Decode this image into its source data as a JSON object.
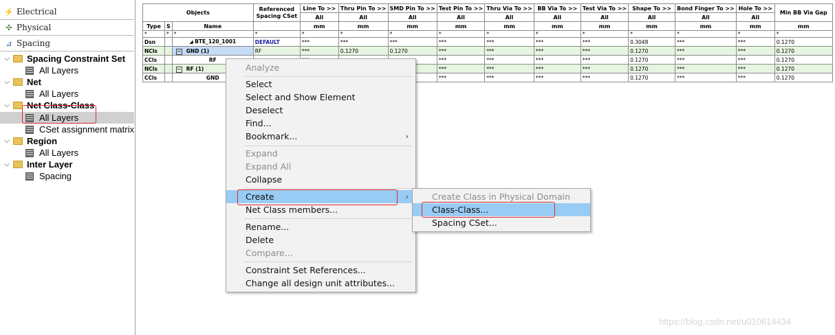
{
  "left_tabs": [
    {
      "label": "Electrical",
      "icon": "lightning-icon"
    },
    {
      "label": "Physical",
      "icon": "physical-icon"
    },
    {
      "label": "Spacing",
      "icon": "spacing-icon"
    }
  ],
  "tree": [
    {
      "label": "Spacing Constraint Set",
      "kind": "folder"
    },
    {
      "label": "All Layers",
      "kind": "layer"
    },
    {
      "label": "Net",
      "kind": "folder"
    },
    {
      "label": "All Layers",
      "kind": "layer"
    },
    {
      "label": "Net Class-Class",
      "kind": "folder"
    },
    {
      "label": "All Layers",
      "kind": "layer"
    },
    {
      "label": "CSet assignment matrix",
      "kind": "layer"
    },
    {
      "label": "Region",
      "kind": "folder"
    },
    {
      "label": "All Layers",
      "kind": "layer"
    },
    {
      "label": "Inter Layer",
      "kind": "folder"
    },
    {
      "label": "Spacing",
      "kind": "layer"
    }
  ],
  "table": {
    "objects": "Objects",
    "ref_cset": "Referenced Spacing CSet",
    "type": "Type",
    "s": "S",
    "name": "Name",
    "columns": [
      "Line To >>",
      "Thru Pin To >>",
      "SMD Pin To >>",
      "Test Pin To >>",
      "Thru Via To >>",
      "BB Via To >>",
      "Test Via To >>",
      "Shape To >>",
      "Bond Finger To >>",
      "Hole To >>",
      "Min BB Via Gap"
    ],
    "all": "All",
    "unit": "mm",
    "filter": "*",
    "rows": [
      {
        "type": "Dsn",
        "name": "BTE_120_1001",
        "cset": "DEFAULT",
        "vals": [
          "***",
          "***",
          "***",
          "***",
          "***",
          "***",
          "***",
          "0.3048",
          "***",
          "***",
          "0.1270"
        ]
      },
      {
        "type": "NCls",
        "name": "GND (1)",
        "cset": "RF",
        "vals": [
          "***",
          "0.1270",
          "0.1270",
          "***",
          "***",
          "***",
          "***",
          "0.1270",
          "***",
          "***",
          "0.1270"
        ]
      },
      {
        "type": "CCls",
        "name": "RF",
        "cset": "",
        "vals": [
          "***",
          "",
          "",
          "***",
          "***",
          "***",
          "***",
          "0.1270",
          "***",
          "***",
          "0.1270"
        ]
      },
      {
        "type": "NCls",
        "name": "RF (1)",
        "cset": "",
        "vals": [
          "***",
          "",
          "",
          "***",
          "***",
          "***",
          "***",
          "0.1270",
          "***",
          "***",
          "0.1270"
        ]
      },
      {
        "type": "CCls",
        "name": "GND",
        "cset": "",
        "vals": [
          "***",
          "",
          "",
          "***",
          "***",
          "***",
          "***",
          "0.1270",
          "***",
          "***",
          "0.1270"
        ]
      }
    ]
  },
  "context_menu": [
    {
      "label": "Analyze",
      "disabled": true
    },
    {
      "sep": true
    },
    {
      "label": "Select"
    },
    {
      "label": "Select and Show Element"
    },
    {
      "label": "Deselect"
    },
    {
      "label": "Find..."
    },
    {
      "label": "Bookmark...",
      "submenu": true
    },
    {
      "sep": true
    },
    {
      "label": "Expand",
      "disabled": true
    },
    {
      "label": "Expand All",
      "disabled": true
    },
    {
      "label": "Collapse"
    },
    {
      "sep": true
    },
    {
      "label": "Create",
      "submenu": true,
      "highlight": true
    },
    {
      "label": "Net Class members..."
    },
    {
      "sep": true
    },
    {
      "label": "Rename..."
    },
    {
      "label": "Delete"
    },
    {
      "label": "Compare...",
      "disabled": true
    },
    {
      "sep": true
    },
    {
      "label": "Constraint Set References..."
    },
    {
      "label": "Change all design unit attributes..."
    }
  ],
  "submenu": [
    {
      "label": "Create Class in Physical Domain",
      "disabled": true
    },
    {
      "label": "Class-Class...",
      "highlight": true
    },
    {
      "label": "Spacing CSet..."
    }
  ],
  "watermark": "https://blog.csdn.net/u010614434",
  "colors": {
    "highlight": "#99ccf5",
    "annotation_red": "#d9262b",
    "net_class_row": "#e6f5e0",
    "cset_link": "#1a1aa0"
  }
}
